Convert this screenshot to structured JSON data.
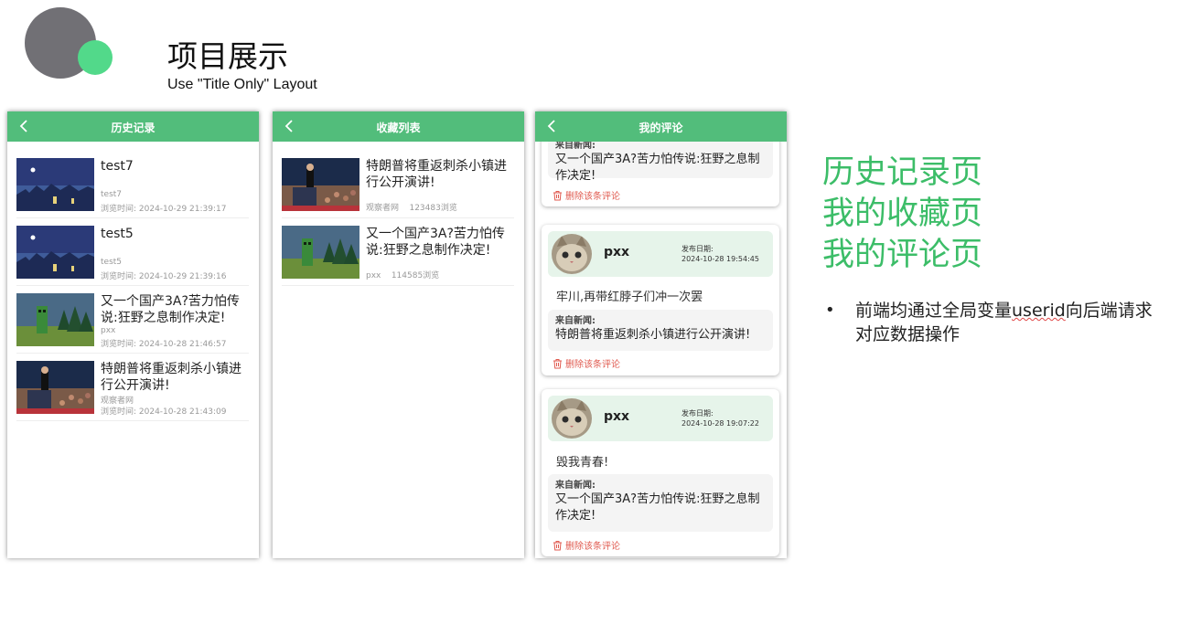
{
  "slide": {
    "title": "项目展示",
    "subtitle": "Use \"Title Only\" Layout"
  },
  "history_screen": {
    "title": "历史记录",
    "items": [
      {
        "title": "test7",
        "source": "test7",
        "time": "浏览时间:   2024-10-29 21:39:17",
        "thumb": "city-night"
      },
      {
        "title": "test5",
        "source": "test5",
        "time": "浏览时间:   2024-10-29 21:39:16",
        "thumb": "city-night"
      },
      {
        "title": "又一个国产3A?苦力怕传说:狂野之息制作决定!",
        "source": "pxx",
        "time": "浏览时间:   2024-10-28 21:46:57",
        "thumb": "game-forest"
      },
      {
        "title": "特朗普将重返刺杀小镇进行公开演讲!",
        "source": "观察者网",
        "time": "浏览时间:   2024-10-28 21:43:09",
        "thumb": "rally-stage"
      }
    ]
  },
  "favorites_screen": {
    "title": "收藏列表",
    "items": [
      {
        "title": "特朗普将重返刺杀小镇进行公开演讲!",
        "source": "观察者网",
        "views": "123483浏览",
        "thumb": "rally-stage"
      },
      {
        "title": "又一个国产3A?苦力怕传说:狂野之息制作决定!",
        "source": "pxx",
        "views": "114585浏览",
        "thumb": "game-forest"
      }
    ]
  },
  "comments_screen": {
    "title": "我的评论",
    "partial_card": {
      "news_from": "来自新闻:",
      "news_title": "又一个国产3A?苦力怕传说:狂野之息制作决定!",
      "delete_label": "删除该条评论"
    },
    "cards": [
      {
        "username": "pxx",
        "date_label": "发布日期:",
        "date": "2024-10-28 19:54:45",
        "comment": "牢川,再带红脖子们冲一次罢",
        "news_from": "来自新闻:",
        "news_title": "特朗普将重返刺杀小镇进行公开演讲!",
        "delete_label": "删除该条评论"
      },
      {
        "username": "pxx",
        "date_label": "发布日期:",
        "date": "2024-10-28 19:07:22",
        "comment": "毁我青春!",
        "news_from": "来自新闻:",
        "news_title": "又一个国产3A?苦力怕传说:狂野之息制作决定!",
        "delete_label": "删除该条评论"
      }
    ]
  },
  "pages_list": [
    "历史记录页",
    "我的收藏页",
    "我的评论页"
  ],
  "bullet": {
    "before": "前端均通过全局变量",
    "highlight": "userid",
    "after": "向后端请求对应数据操作"
  },
  "colors": {
    "header_green": "#52bd7b",
    "accent_green": "#3cbd68",
    "deco_gray": "#717075",
    "deco_green": "#52d98a",
    "delete_red": "#e05a4f"
  }
}
